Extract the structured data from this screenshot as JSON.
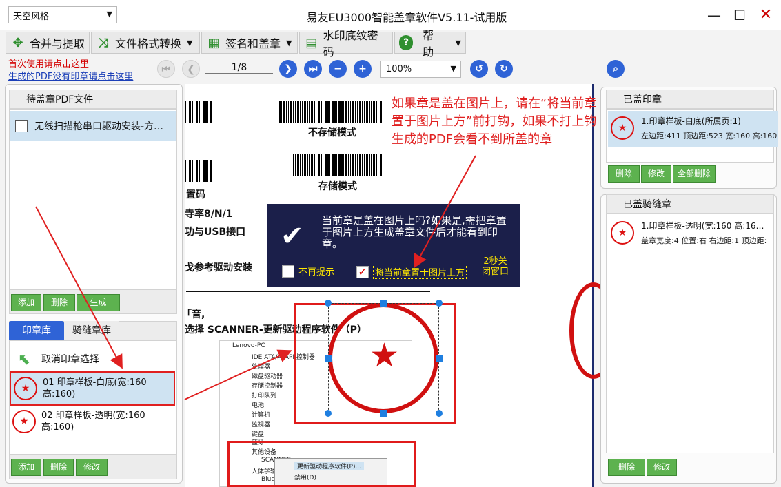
{
  "window": {
    "skin_select": "天空风格",
    "title": "易友EU3000智能盖章软件V5.11-试用版",
    "min_glyph": "—",
    "max_glyph": "☐",
    "close_glyph": "✕"
  },
  "toolbar": {
    "merge": "合并与提取",
    "convert": "文件格式转换",
    "sign": "签名和盖章",
    "watermark": "水印底纹密码",
    "help": "帮助"
  },
  "links": {
    "first_use": "首次使用请点击这里",
    "no_stamp": "生成的PDF没有印章请点击这里"
  },
  "nav": {
    "page": "1/8",
    "zoom": "100%"
  },
  "left": {
    "pending_header": "待盖章PDF文件",
    "pdf_item": "无线扫描枪串口驱动安装-方…",
    "add": "添加",
    "delete": "删除",
    "generate": "生成",
    "tab_lib": "印章库",
    "tab_seam": "骑缝章库",
    "cancel_select": "取消印章选择",
    "stamp1": "01 印章样板-白底(宽:160 高:160)",
    "stamp2": "02 印章样板-透明(宽:160 高:160)",
    "add2": "添加",
    "delete2": "删除",
    "modify2": "修改"
  },
  "doc": {
    "mode_no_store": "不存储模式",
    "mode_store": "存储模式",
    "line_code": "置码",
    "line_baud": "寺率8/N/1",
    "line_usb": "功与USB接口",
    "line_ref": "戈参考驱动安装",
    "line_sound": "「音,",
    "line_select": "选择 SCANNER-更新驱动程序软件（P）",
    "dev_root": "Lenovo-PC",
    "dev_ide": "IDE ATA/ATAPI 控制器",
    "dev_cpu": "处理器",
    "dev_disk": "磁盘驱动器",
    "dev_storage": "存储控制器",
    "dev_print": "打印队列",
    "dev_battery": "电池",
    "dev_computer": "计算机",
    "dev_monitor": "监视器",
    "dev_keyboard": "键盘",
    "dev_bluetooth": "蓝牙",
    "dev_other": "其他设备",
    "dev_scanner": "SCANNER",
    "dev_hid": "人体学输",
    "dev_blue2": "Blue",
    "ctx_update": "更新驱动程序软件(P)...",
    "ctx_disable": "禁用(D)"
  },
  "tip": {
    "red_text": "如果章是盖在图片上，请在“将当前章置于图片上方”前打钩，如果不打上钩生成的PDF会看不到所盖的章"
  },
  "dialog": {
    "message": "当前章是盖在图片上吗?如果是,需把章置于图片上方生成盖章文件后才能看到印章。",
    "no_remind": "不再提示",
    "place_top": "将当前章置于图片上方",
    "countdown": "2秒关",
    "close": "闭窗口"
  },
  "right": {
    "stamped_header": "已盖印章",
    "stamped_item_title": "1.印章样板-白底(所属页:1)",
    "stamped_item_detail": "左边距:411 顶边距:523 宽:160 高:160",
    "del": "删除",
    "modify": "修改",
    "del_all": "全部删除",
    "seam_header": "已盖骑缝章",
    "seam_item_title": "1.印章样板-透明(宽:160 高:16…",
    "seam_item_detail": "盖章宽度:4 位置:右 右边距:1 顶边距:",
    "del2": "删除",
    "modify3": "修改"
  },
  "colors": {
    "accent_blue": "#2f63d6",
    "button_green": "#5db24f",
    "stamp_red": "#d01010",
    "dialog_bg": "#1b1f4a"
  }
}
